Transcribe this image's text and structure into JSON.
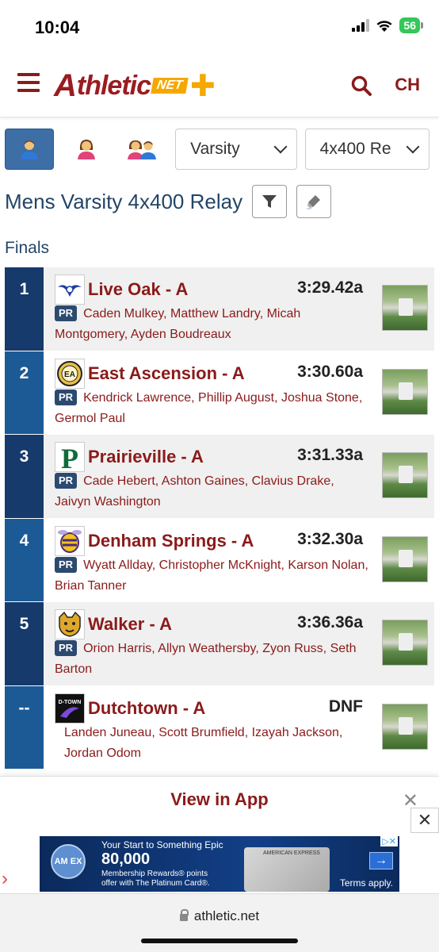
{
  "status_bar": {
    "time": "10:04",
    "battery": "56"
  },
  "header": {
    "logo_main": "thletic",
    "logo_a": "A",
    "logo_net": "NET",
    "profile_initials": "CH"
  },
  "filters": {
    "level": "Varsity",
    "event": "4x400 Re"
  },
  "page_title": "Mens Varsity 4x400 Relay",
  "section": "Finals",
  "results": [
    {
      "place": "1",
      "team": "Live Oak - A",
      "mark": "3:29.42a",
      "pr": "PR",
      "runners": "Caden Mulkey, Matthew Landry, Micah Montgomery, Ayden Boudreaux",
      "logo_text": "W"
    },
    {
      "place": "2",
      "team": "East Ascension - A",
      "mark": "3:30.60a",
      "pr": "PR",
      "runners": "Kendrick Lawrence, Phillip August, Joshua Stone, Germol Paul",
      "logo_text": "EA"
    },
    {
      "place": "3",
      "team": "Prairieville - A",
      "mark": "3:31.33a",
      "pr": "PR",
      "runners": "Cade Hebert, Ashton Gaines, Clavius Drake, Jaivyn Washington",
      "logo_text": "P"
    },
    {
      "place": "4",
      "team": "Denham Springs - A",
      "mark": "3:32.30a",
      "pr": "PR",
      "runners": "Wyatt Allday, Christopher McKnight, Karson Nolan, Brian Tanner",
      "logo_text": ""
    },
    {
      "place": "5",
      "team": "Walker - A",
      "mark": "3:36.36a",
      "pr": "PR",
      "runners": "Orion Harris, Allyn Weathersby, Zyon Russ, Seth Barton",
      "logo_text": ""
    },
    {
      "place": "--",
      "team": "Dutchtown - A",
      "mark": "DNF",
      "pr": "",
      "runners": "Landen Juneau, Scott Brumfield, Izayah Jackson, Jordan Odom",
      "logo_text": "D-TOWN"
    }
  ],
  "app_banner": {
    "label": "View in App"
  },
  "ad": {
    "logo": "AM EX",
    "line1": "Your Start to Something Epic",
    "line2": "80,000",
    "line3a": "Membership Rewards® points",
    "line3b": "offer with The Platinum Card®.",
    "card_text": "AMERICAN EXPRESS",
    "terms": "Terms apply."
  },
  "browser": {
    "url": "athletic.net"
  },
  "colors": {
    "brand": "#8b1a1a",
    "accent": "#f5a800",
    "place_dark": "#163a6b",
    "place_light": "#1c5a96"
  }
}
